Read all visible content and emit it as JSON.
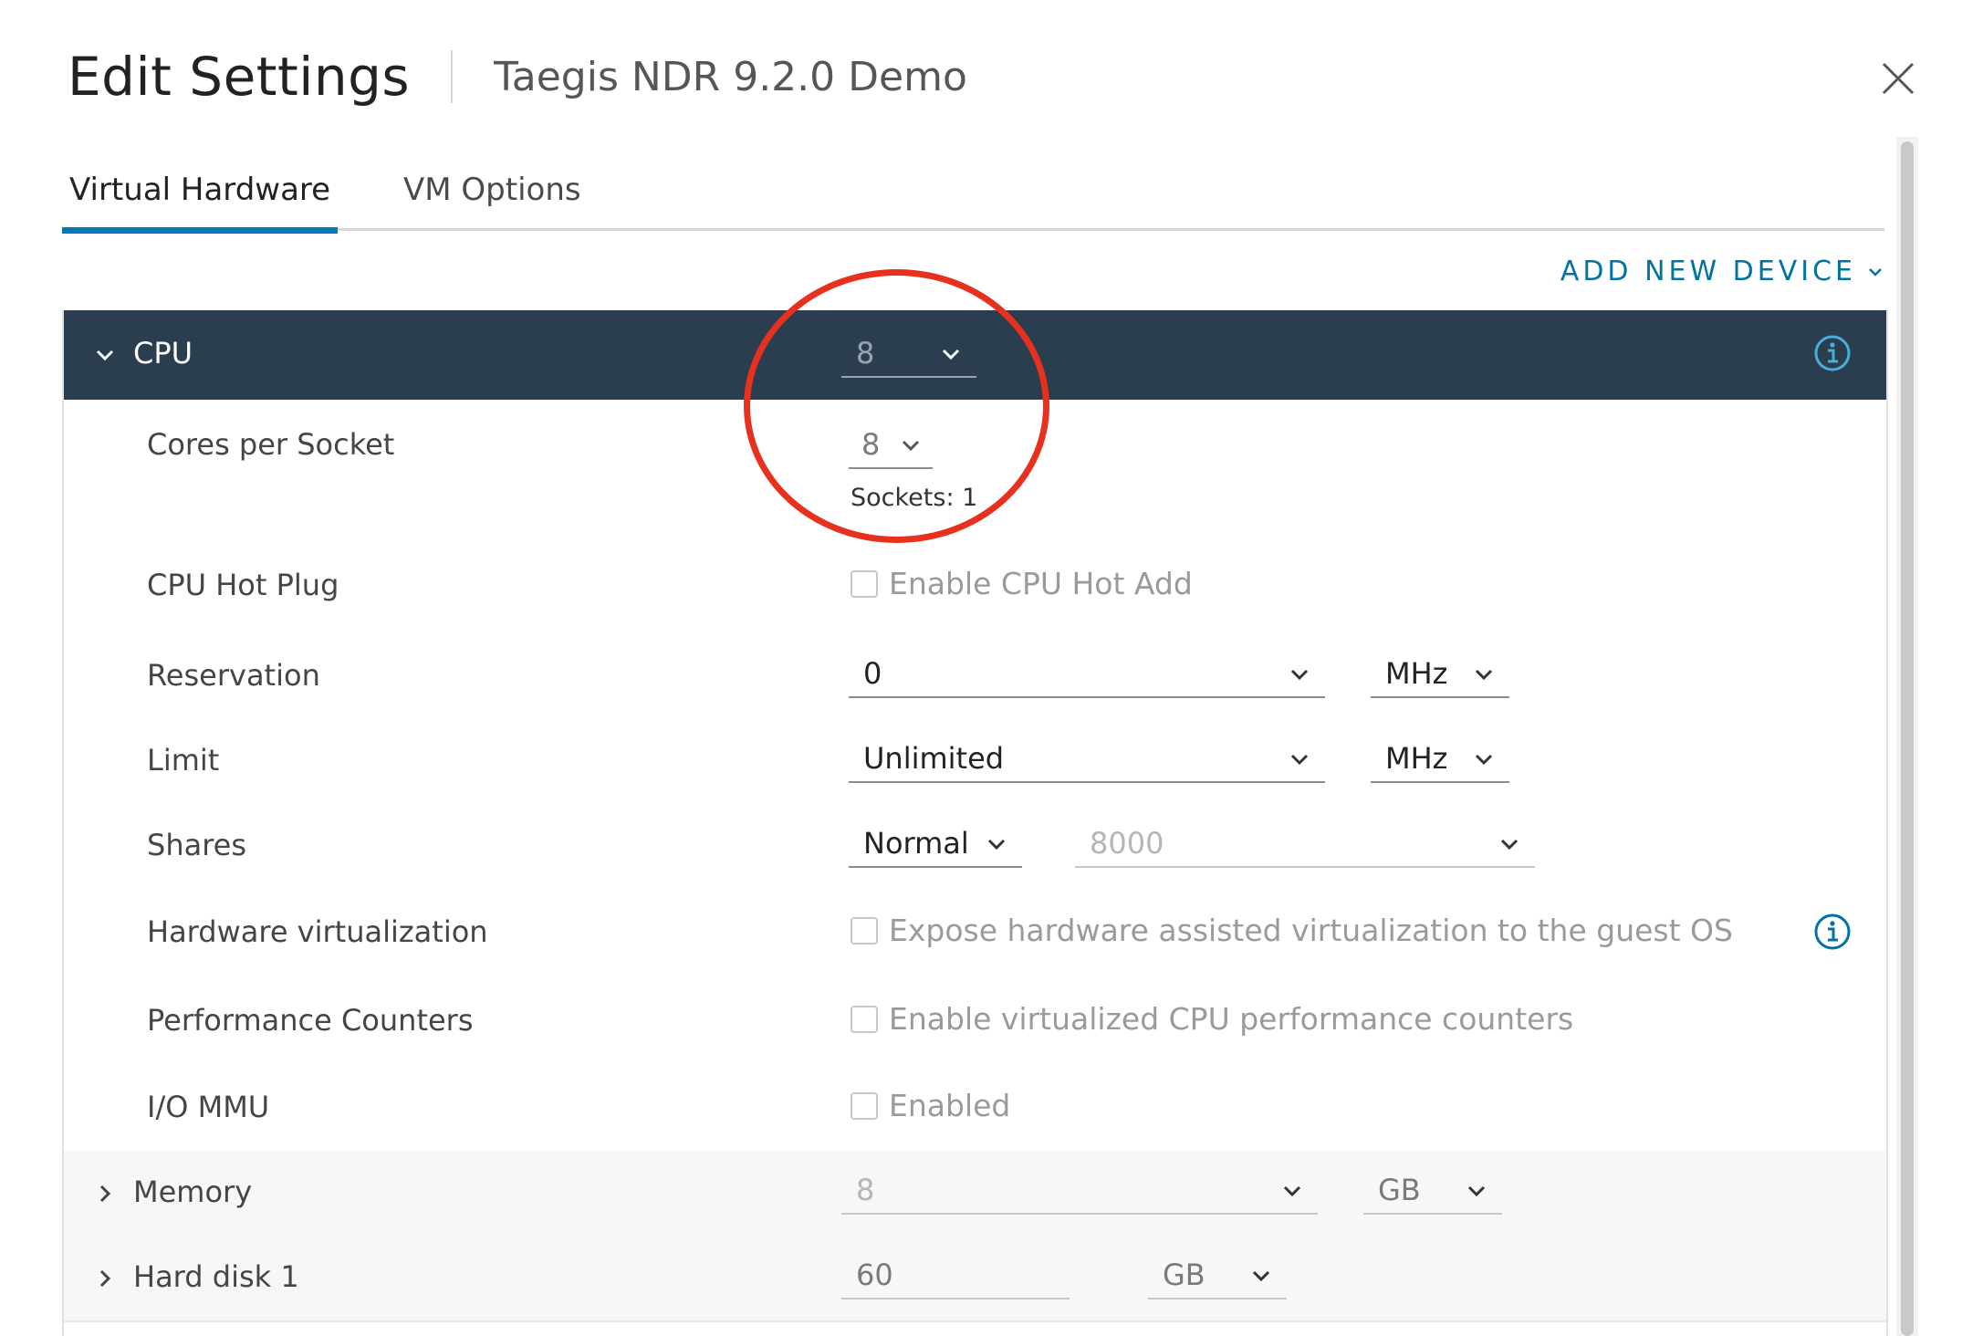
{
  "dialog": {
    "title": "Edit Settings",
    "vm_name": "Taegis NDR 9.2.0 Demo"
  },
  "tabs": [
    {
      "label": "Virtual Hardware",
      "active": true
    },
    {
      "label": "VM Options",
      "active": false
    }
  ],
  "add_device_label": "ADD NEW DEVICE",
  "colors": {
    "accent": "#0079b8",
    "header_bg": "#2b3e4f",
    "annotation": "#e8301f"
  },
  "cpu": {
    "label": "CPU",
    "value": "8",
    "cores_per_socket": {
      "label": "Cores per Socket",
      "value": "8",
      "sockets_note": "Sockets: 1"
    },
    "hot_plug": {
      "label": "CPU Hot Plug",
      "checkbox_label": "Enable CPU Hot Add",
      "checked": false
    },
    "reservation": {
      "label": "Reservation",
      "value": "0",
      "unit": "MHz"
    },
    "limit": {
      "label": "Limit",
      "value": "Unlimited",
      "unit": "MHz"
    },
    "shares": {
      "label": "Shares",
      "level": "Normal",
      "value": "8000"
    },
    "hw_virtualization": {
      "label": "Hardware virtualization",
      "checkbox_label": "Expose hardware assisted virtualization to the guest OS",
      "checked": false
    },
    "perf_counters": {
      "label": "Performance Counters",
      "checkbox_label": "Enable virtualized CPU performance counters",
      "checked": false
    },
    "iommu": {
      "label": "I/O MMU",
      "checkbox_label": "Enabled",
      "checked": false
    }
  },
  "memory": {
    "label": "Memory",
    "value": "8",
    "unit": "GB"
  },
  "hard_disk": {
    "label": "Hard disk 1",
    "value": "60",
    "unit": "GB"
  }
}
